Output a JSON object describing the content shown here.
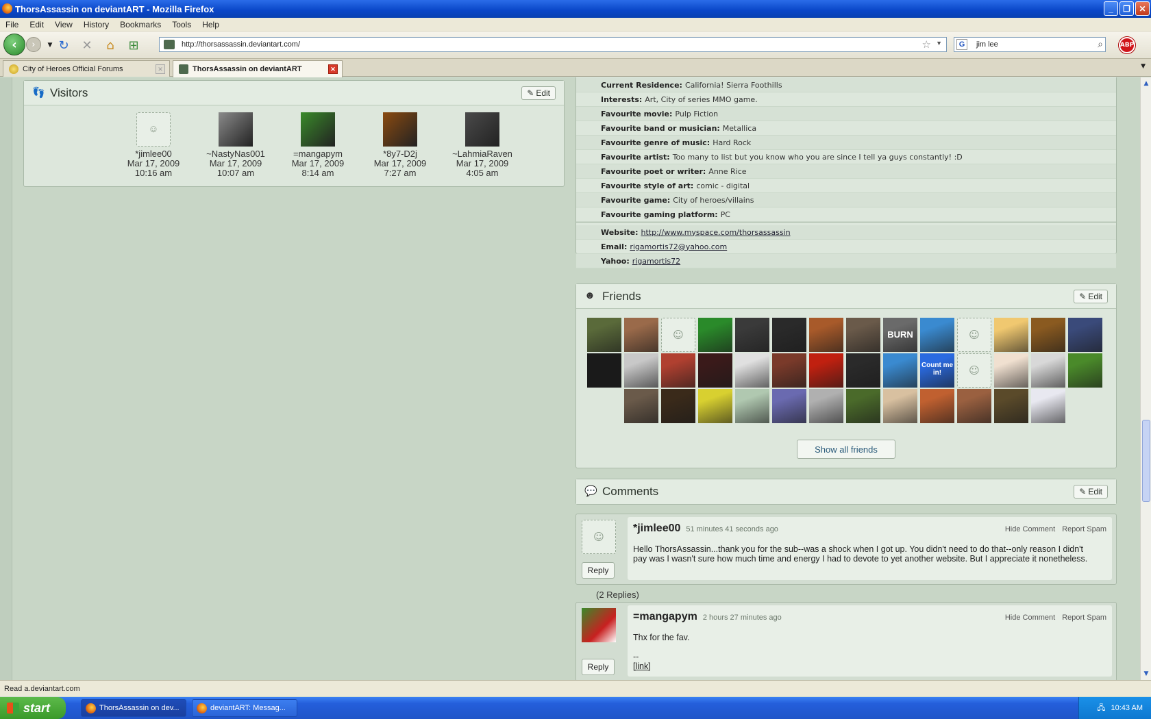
{
  "window": {
    "title": "ThorsAssassin on deviantART - Mozilla Firefox"
  },
  "menu": [
    "File",
    "Edit",
    "View",
    "History",
    "Bookmarks",
    "Tools",
    "Help"
  ],
  "nav": {
    "url": "http://thorsassassin.deviantart.com/",
    "search_value": "jim lee",
    "abp_label": "ABP"
  },
  "tabs": [
    {
      "label": "City of Heroes Official Forums",
      "active": false
    },
    {
      "label": "ThorsAssassin on deviantART",
      "active": true
    }
  ],
  "visitors": {
    "title": "Visitors",
    "edit_label": "Edit",
    "items": [
      {
        "name": "*jimlee00",
        "date": "Mar 17, 2009",
        "time": "10:16 am",
        "avatar": "blank"
      },
      {
        "name": "~NastyNas001",
        "date": "Mar 17, 2009",
        "time": "10:07 am",
        "avatar": "#8a8a8a"
      },
      {
        "name": "=mangapym",
        "date": "Mar 17, 2009",
        "time": "8:14 am",
        "avatar": "#3a8a2a"
      },
      {
        "name": "*8y7-D2j",
        "date": "Mar 17, 2009",
        "time": "7:27 am",
        "avatar": "#8a4a10"
      },
      {
        "name": "~LahmiaRaven",
        "date": "Mar 17, 2009",
        "time": "4:05 am",
        "avatar": "#4a4a4a"
      }
    ]
  },
  "profile": {
    "rows": [
      {
        "label": "Current Residence:",
        "value": "California! Sierra Foothills"
      },
      {
        "label": "Interests:",
        "value": "Art, City of series MMO game."
      },
      {
        "label": "Favourite movie:",
        "value": "Pulp Fiction"
      },
      {
        "label": "Favourite band or musician:",
        "value": "Metallica"
      },
      {
        "label": "Favourite genre of music:",
        "value": "Hard Rock"
      },
      {
        "label": "Favourite artist:",
        "value": "Too many to list but you know who you are since I tell ya guys constantly! :D"
      },
      {
        "label": "Favourite poet or writer:",
        "value": "Anne Rice"
      },
      {
        "label": "Favourite style of art:",
        "value": "comic - digital"
      },
      {
        "label": "Favourite game:",
        "value": "City of heroes/villains"
      },
      {
        "label": "Favourite gaming platform:",
        "value": "PC"
      }
    ],
    "links": [
      {
        "label": "Website:",
        "value": "http://www.myspace.com/thorsassassin"
      },
      {
        "label": "Email:",
        "value": "rigamortis72@yahoo.com"
      },
      {
        "label": "Yahoo:",
        "value": "rigamortis72"
      }
    ]
  },
  "friends": {
    "title": "Friends",
    "edit_label": "Edit",
    "show_all_label": "Show all friends",
    "avatars": [
      "#5a6a3a",
      "#9a6a4a",
      "blank",
      "#2a8a2a",
      "#3a3a3a",
      "#2a2a2a",
      "#a85a2a",
      "#6a5a4a",
      "#6a6a6a",
      "#3a8ad0",
      "blank",
      "#f0c870",
      "#8a5a20",
      "#3a4a7a",
      "#1a1a1a",
      "#c8c8c8",
      "#b04030",
      "#3a1a1a",
      "#e0e0e0",
      "#7a3a2a",
      "#c02010",
      "#2a2a2a",
      "#3a8ad0",
      "#2a6ae0",
      "blank",
      "#f0e0d0",
      "#d8d8d8",
      "#4a8a2a",
      "#6a5a4a",
      "#3a2a1a",
      "#d8d030",
      "#b0c8b0",
      "#6a6ab0",
      "#b0b0b0",
      "#4a6a2a",
      "#d8c0a0",
      "#c06030",
      "#9a6040",
      "#5a4a2a",
      "#e8e8f0"
    ],
    "count_me_in_text": "Count me in!",
    "burn_text": "BURN"
  },
  "comments": {
    "title": "Comments",
    "edit_label": "Edit",
    "items": [
      {
        "author": "*jimlee00",
        "time": "51 minutes 41 seconds ago",
        "hide_label": "Hide Comment",
        "spam_label": "Report Spam",
        "reply_label": "Reply",
        "text": "Hello ThorsAssassin...thank you for the sub--was a shock when I got up. You didn't need to do that--only reason I didn't pay was I wasn't sure how much time and energy I had to devote to yet another website. But I appreciate it nonetheless."
      },
      {
        "author": "=mangapym",
        "time": "2 hours 27 minutes ago",
        "hide_label": "Hide Comment",
        "spam_label": "Report Spam",
        "reply_label": "Reply",
        "text": "Thx for the fav.",
        "sig": "--",
        "link": "[link]"
      }
    ],
    "replies_count": "(2 Replies)"
  },
  "status": {
    "text": "Read a.deviantart.com"
  },
  "taskbar": {
    "start_label": "start",
    "tasks": [
      "ThorsAssassin on dev...",
      "deviantART: Messag..."
    ],
    "clock": "10:43 AM"
  }
}
